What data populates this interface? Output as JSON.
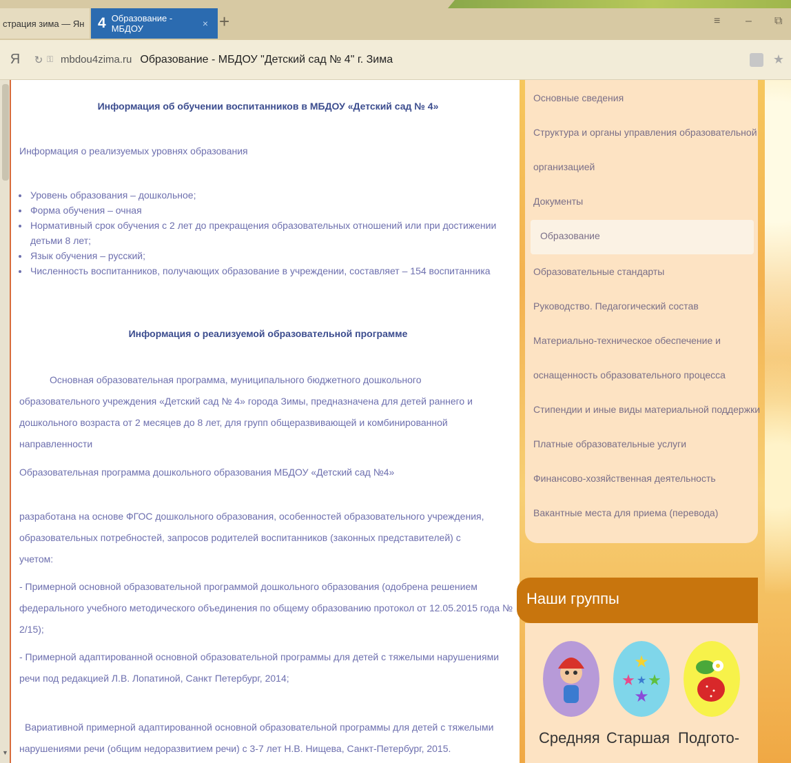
{
  "browser": {
    "tabs": [
      {
        "label": "страция зима — Ян",
        "num": ""
      },
      {
        "label": "Образование - МБДОУ",
        "num": "4"
      }
    ],
    "new_tab": "+",
    "close_tab": "×",
    "menu_glyph": "≡",
    "minimize_glyph": "–",
    "restore_glyph": "⧉",
    "y_button": "Я",
    "domain": "mbdou4zima.ru",
    "page_title": "Образование - МБДОУ \"Детский сад № 4\" г. Зима"
  },
  "main": {
    "heading": "Информация об обучении воспитанников в МБДОУ «Детский сад № 4»",
    "levels_intro": "Информация о реализуемых уровнях образования",
    "bullets": [
      "Уровень образования – дошкольное;",
      "Форма обучения – очная",
      "Нормативный срок обучения с 2 лет до прекращения образовательных отношений или при достижении детьми 8 лет;",
      "Язык обучения – русский;",
      "Численность воспитанников, получающих образование в учреждении, составляет – 154 воспитанника"
    ],
    "program_heading": "Информация о реализуемой образовательной программе",
    "para1": "Основная образовательная программа, муниципального бюджетного дошкольного образовательного учреждения «Детский сад № 4» города Зимы, предназначена для детей раннего и дошкольного возраста от 2 месяцев до 8 лет, для групп общеразвивающей и комбинированной направленности",
    "para2": "Образовательная программа дошкольного образования МБДОУ «Детский сад №4»",
    "para3": "разработана на основе ФГОС дошкольного образования, особенностей образовательного учреждения, образовательных потребностей, запросов родителей воспитанников (законных представителей) с учетом:",
    "para4": "- Примерной основной образовательной программой дошкольного образования (одобрена решением федерального учебного методического объединения по общему образованию протокол от 12.05.2015 года № 2/15);",
    "para5": "- Примерной адаптированной основной образовательной программы для детей с тяжелыми нарушениями речи под редакцией Л.В. Лопатиной, Санкт Петербург, 2014;",
    "para6": "Вариативной примерной адаптированной основной образовательной программы для детей с тяжелыми нарушениями речи (общим недоразвитием речи) с 3-7 лет Н.В. Нищева, Санкт-Петербург, 2015."
  },
  "sidebar": {
    "items": [
      "Основные сведения",
      "Структура и органы управления образовательной",
      "организацией",
      "Документы",
      "Образование",
      "Образовательные стандарты",
      "Руководство. Педагогический состав",
      "Материально-техническое обеспечение и",
      "оснащенность образовательного процесса",
      "Стипендии и иные виды материальной поддержки",
      "Платные образовательные услуги",
      "Финансово-хозяйственная деятельность",
      "Вакантные места для приема (перевода)"
    ],
    "groups_title": "Наши группы",
    "groups": [
      "Средняя",
      "Старшая",
      "Подгото-"
    ]
  },
  "colors": {
    "accent_tab": "#2b6bb0",
    "heading": "#3b4c8e",
    "body_text": "#6d6fae",
    "sidebar_bg": "#fde3c3",
    "groups_header": "#c8750d"
  }
}
